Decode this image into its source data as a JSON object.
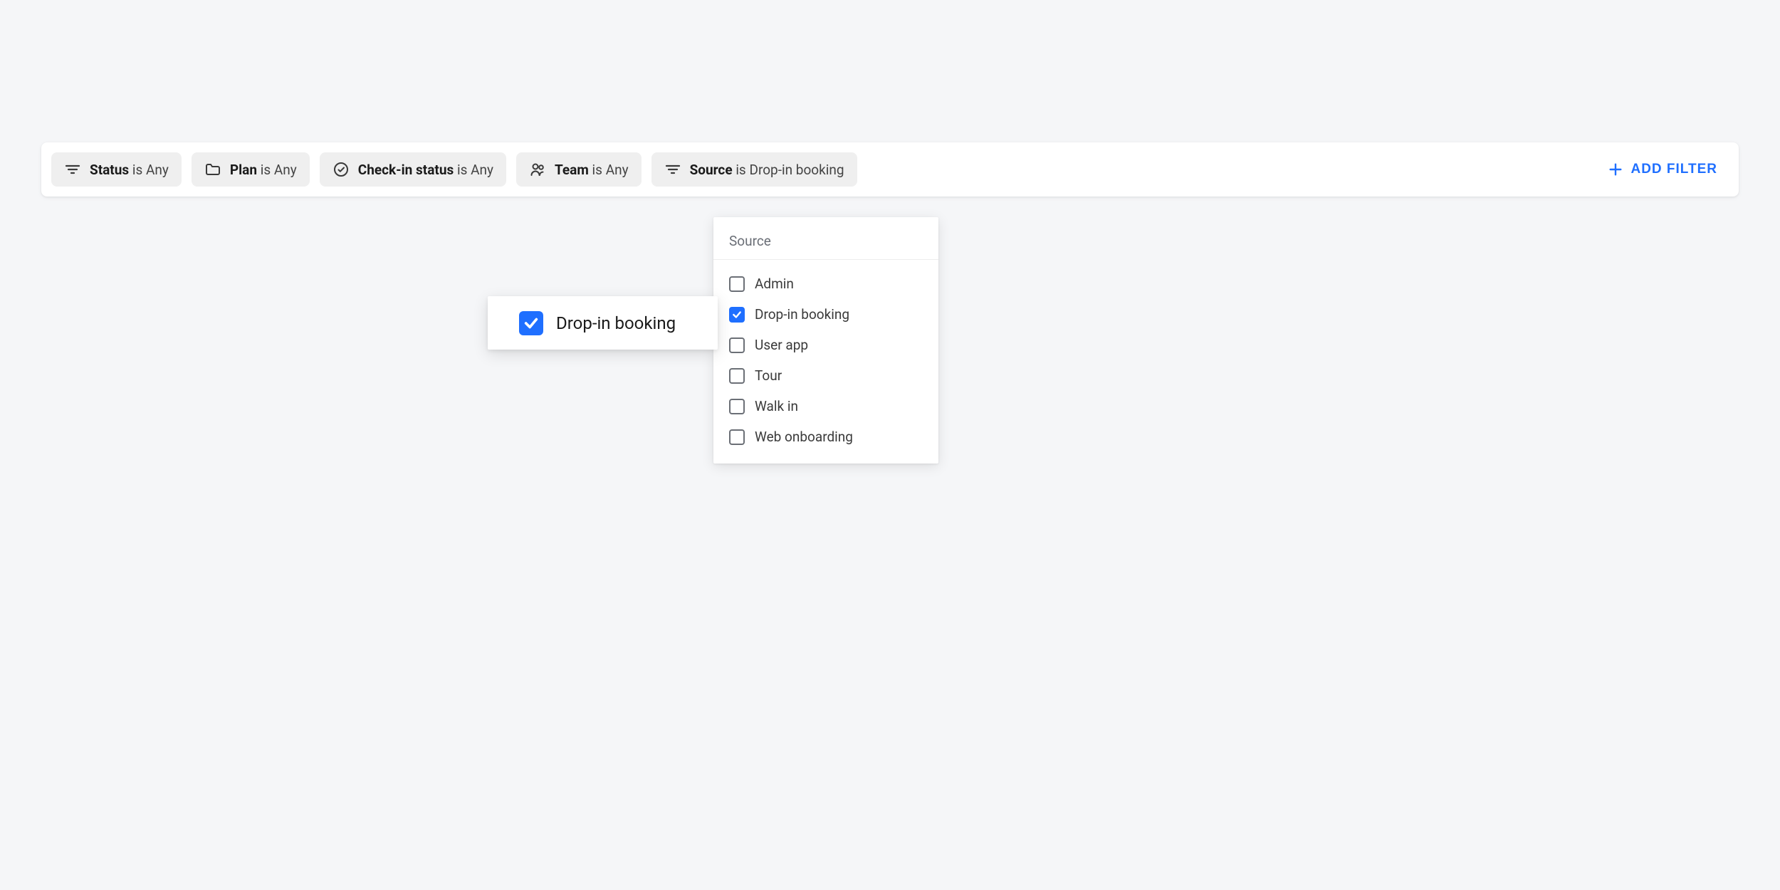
{
  "filters": [
    {
      "icon": "filter",
      "label": "Status",
      "operator": "is",
      "value": "Any"
    },
    {
      "icon": "folder",
      "label": "Plan",
      "operator": "is",
      "value": "Any"
    },
    {
      "icon": "check-circle",
      "label": "Check-in status",
      "operator": "is",
      "value": "Any"
    },
    {
      "icon": "team",
      "label": "Team",
      "operator": "is",
      "value": "Any"
    },
    {
      "icon": "filter",
      "label": "Source",
      "operator": "is",
      "value": "Drop-in booking"
    }
  ],
  "add_filter_label": "ADD FILTER",
  "dropdown": {
    "title": "Source",
    "items": [
      {
        "label": "Admin",
        "checked": false
      },
      {
        "label": "Drop-in booking",
        "checked": true
      },
      {
        "label": "User app",
        "checked": false
      },
      {
        "label": "Tour",
        "checked": false
      },
      {
        "label": "Walk in",
        "checked": false
      },
      {
        "label": "Web onboarding",
        "checked": false
      }
    ]
  },
  "highlight": {
    "label": "Drop-in booking"
  }
}
